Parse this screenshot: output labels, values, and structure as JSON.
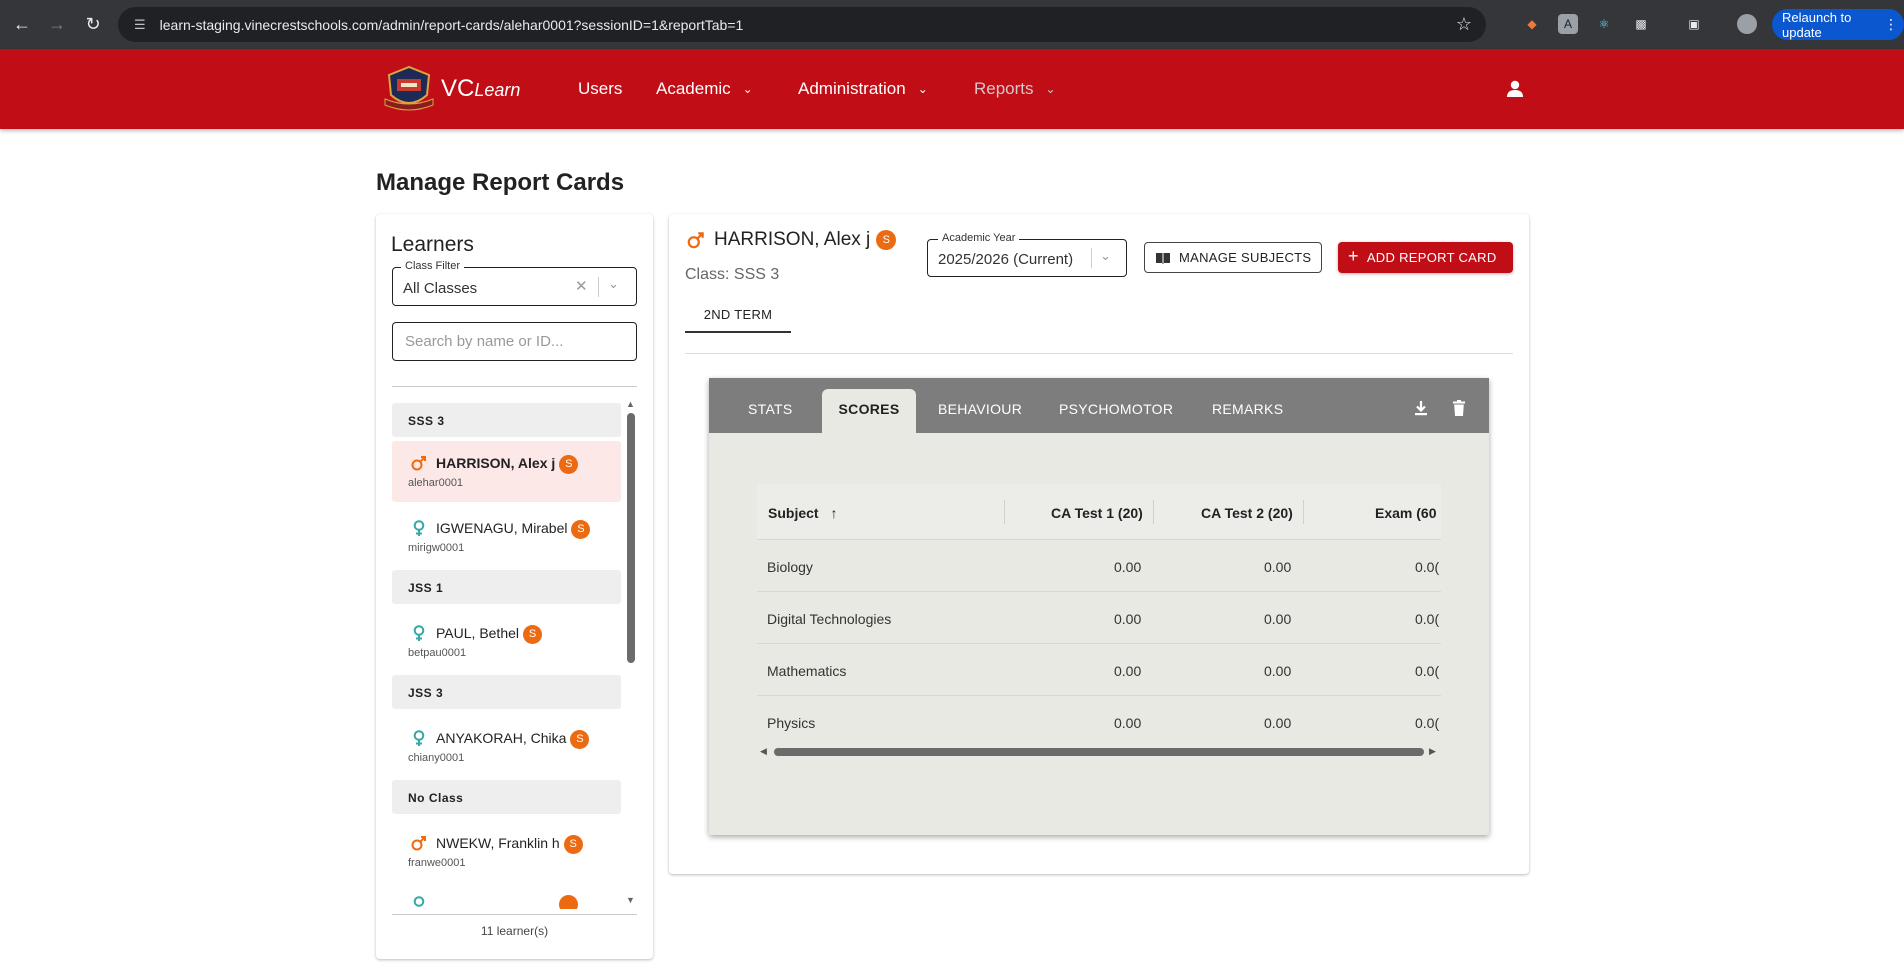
{
  "browser": {
    "url": "learn-staging.vinecrestschools.com/admin/report-cards/alehar0001?sessionID=1&reportTab=1",
    "relaunch_label": "Relaunch to update"
  },
  "app": {
    "brand_main": "VC",
    "brand_sub": "Learn",
    "nav": [
      {
        "label": "Users"
      },
      {
        "label": "Academic"
      },
      {
        "label": "Administration"
      },
      {
        "label": "Reports"
      }
    ],
    "colors": {
      "primary": "#c10d15",
      "badge": "#ec6a12",
      "male": "#ec6a12",
      "female": "#36a7a7"
    }
  },
  "page": {
    "title": "Manage Report Cards"
  },
  "learners_panel": {
    "title": "Learners",
    "class_filter": {
      "label": "Class Filter",
      "value": "All Classes"
    },
    "search": {
      "placeholder": "Search by name or ID..."
    },
    "badge": "S",
    "groups": [
      {
        "name": "SSS 3",
        "learners": [
          {
            "name": "HARRISON, Alex j",
            "id": "alehar0001",
            "gender": "male",
            "active": true
          },
          {
            "name": "IGWENAGU, Mirabel",
            "id": "mirigw0001",
            "gender": "female",
            "active": false
          }
        ]
      },
      {
        "name": "JSS 1",
        "learners": [
          {
            "name": "PAUL, Bethel",
            "id": "betpau0001",
            "gender": "female",
            "active": false
          }
        ]
      },
      {
        "name": "JSS 3",
        "learners": [
          {
            "name": "ANYAKORAH, Chika",
            "id": "chiany0001",
            "gender": "female",
            "active": false
          }
        ]
      },
      {
        "name": "No Class",
        "learners": [
          {
            "name": "NWEKW, Franklin h",
            "id": "franwe0001",
            "gender": "male",
            "active": false
          }
        ]
      }
    ],
    "count_text": "11 learner(s)"
  },
  "student": {
    "name": "HARRISON, Alex j",
    "badge": "S",
    "class_text": "Class: SSS 3",
    "academic_year": {
      "label": "Academic Year",
      "value": "2025/2026 (Current)"
    },
    "manage_subjects_label": "MANAGE SUBJECTS",
    "add_report_card_label": "ADD REPORT CARD",
    "term_tab": "2ND TERM"
  },
  "report": {
    "tabs": [
      "STATS",
      "SCORES",
      "BEHAVIOUR",
      "PSYCHOMOTOR",
      "REMARKS"
    ],
    "active_tab": "SCORES",
    "columns": [
      "Subject",
      "CA Test 1 (20)",
      "CA Test 2 (20)",
      "Exam (60"
    ],
    "rows": [
      {
        "subject": "Biology",
        "ca1": "0.00",
        "ca2": "0.00",
        "exam": "0.0("
      },
      {
        "subject": "Digital Technologies",
        "ca1": "0.00",
        "ca2": "0.00",
        "exam": "0.0("
      },
      {
        "subject": "Mathematics",
        "ca1": "0.00",
        "ca2": "0.00",
        "exam": "0.0("
      },
      {
        "subject": "Physics",
        "ca1": "0.00",
        "ca2": "0.00",
        "exam": "0.0("
      }
    ]
  }
}
